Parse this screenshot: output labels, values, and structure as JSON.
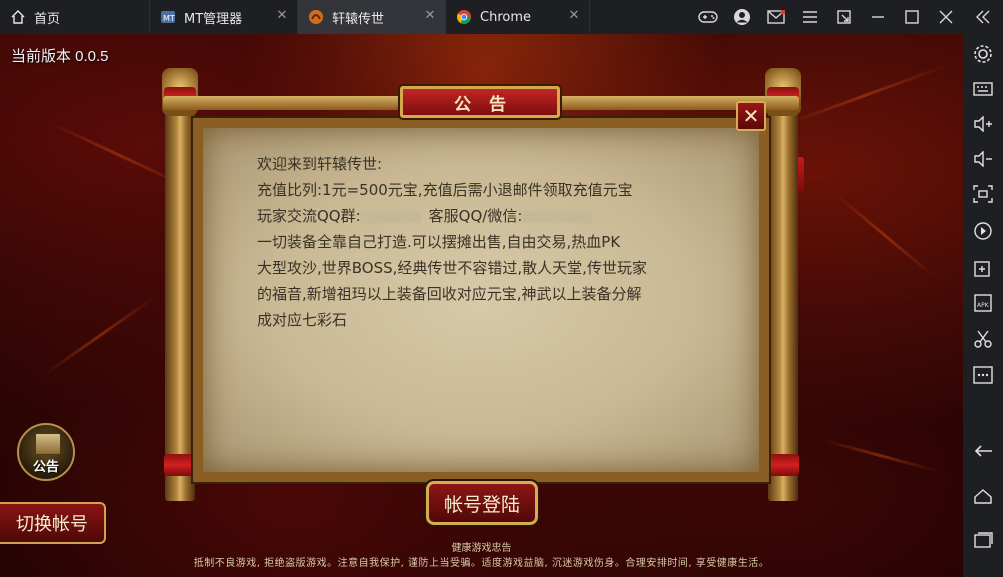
{
  "tabs": [
    {
      "label": "首页",
      "icon": "home-icon",
      "active": false
    },
    {
      "label": "MT管理器",
      "icon": "mt-app-icon",
      "active": false
    },
    {
      "label": "轩辕传世",
      "icon": "game-app-icon",
      "active": true
    },
    {
      "label": "Chrome",
      "icon": "chrome-icon",
      "active": false
    }
  ],
  "title_actions": [
    "gamepad-icon",
    "user-icon",
    "mail-icon",
    "menu-icon",
    "pin-icon",
    "minimize-icon",
    "maximize-icon",
    "close-icon",
    "collapse-sidebar-icon"
  ],
  "sidebar": [
    "settings-icon",
    "keyboard-icon",
    "volume-up-icon",
    "volume-down-icon",
    "screenshot-icon",
    "rotate-icon",
    "add-app-icon",
    "apk-icon",
    "scissors-icon",
    "more-icon",
    "back-icon",
    "home-icon",
    "recents-icon"
  ],
  "game": {
    "version": "当前版本 0.0.5",
    "notice": {
      "title": "公告",
      "lines": {
        "l1": "欢迎来到轩辕传世:",
        "l2": "充值比列:1元=500元宝,充值后需小退邮件领取充值元宝",
        "l3a": "玩家交流QQ群:",
        "l3b": "客服QQ/微信:",
        "l4": "一切装备全靠自己打造.可以摆摊出售,自由交易,热血PK",
        "l5": "大型攻沙,世界BOSS,经典传世不容错过,散人天堂,传世玩家",
        "l6": "的福音,新增祖玛以上装备回收对应元宝,神武以上装备分解",
        "l7": "成对应七彩石"
      }
    },
    "notice_icon_label": "公告",
    "switch_account": "切换帐号",
    "login": "帐号登陆",
    "health_title": "健康游戏忠告",
    "health_text": "抵制不良游戏, 拒绝盗版游戏。注意自我保护, 谨防上当受骗。适度游戏益脑, 沉迷游戏伤身。合理安排时间, 享受健康生活。"
  },
  "colors": {
    "titlebar": "#1e1f22",
    "active_tab": "#33353a",
    "accent_red": "#8c1616",
    "gold": "#d6ab52",
    "parchment": "#c9b893"
  }
}
